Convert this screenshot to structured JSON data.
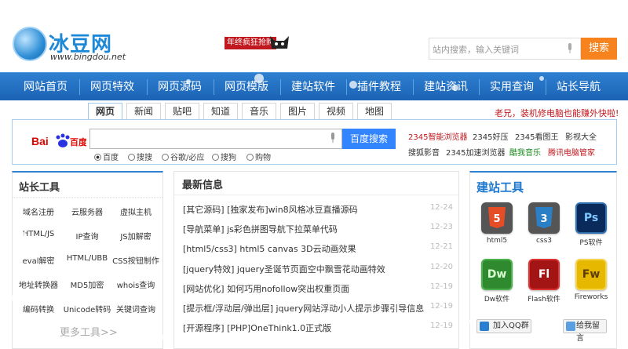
{
  "site": {
    "logo_text": "冰豆网",
    "logo_url": "www.bingdou.net",
    "promo": "年终疯狂抢购",
    "search_placeholder": "站内搜索，输入关键词",
    "search_button": "搜索"
  },
  "nav": [
    "网站首页",
    "网页特效",
    "网页源码",
    "网页模版",
    "建站软件",
    "插件教程",
    "建站资讯",
    "实用查询",
    "站长导航"
  ],
  "tabs": [
    "网页",
    "新闻",
    "贴吧",
    "知道",
    "音乐",
    "图片",
    "视频",
    "地图"
  ],
  "hot_notice": "老兄，装机修电脑也能赚外快啦!",
  "baidu": {
    "logo": "Bai百度",
    "button": "百度搜索",
    "radios": [
      "百度",
      "搜搜",
      "谷歌/必应",
      "搜狗",
      "购物"
    ],
    "links": [
      {
        "text": "2345智能浏览器",
        "color": "#c0181e"
      },
      {
        "text": "2345好压",
        "color": "#333333"
      },
      {
        "text": "2345看图王",
        "color": "#333333"
      },
      {
        "text": "影视大全",
        "color": "#333333"
      },
      {
        "text": "搜狐影音",
        "color": "#333333"
      },
      {
        "text": "2345加速浏览器",
        "color": "#333333"
      },
      {
        "text": "酷我音乐",
        "color": "#1a8a1a"
      },
      {
        "text": "腾讯电脑管家",
        "color": "#c0181e"
      }
    ]
  },
  "tools": {
    "title": "站长工具",
    "items": [
      "域名注册",
      "云服务器",
      "虚拟主机",
      "HTML/JS",
      "IP查询",
      "JS加解密",
      "eval解密",
      "HTML/UBB",
      "CSS按钮制作",
      "地址转换器",
      "MD5加密",
      "whois查询",
      "编码转换",
      "Unicode转码",
      "关键词查询"
    ],
    "more": "更多工具>>"
  },
  "news": {
    "title": "最新信息",
    "items": [
      {
        "text": "[其它源码] [独家发布]win8风格冰豆直播源码",
        "date": "12-24"
      },
      {
        "text": "[导航菜单] js彩色拼图导航下拉菜单代码",
        "date": "12-23"
      },
      {
        "text": "[html5/css3] html5 canvas 3D云动画效果",
        "date": "12-21"
      },
      {
        "text": "[jquery特效] jquery圣诞节页面空中飘雪花动画特效",
        "date": "12-20"
      },
      {
        "text": "[网站优化] 如何巧用nofollow突出权重页面",
        "date": "12-19"
      },
      {
        "text": "[提示框/浮动层/弹出层] jquery网站浮动小人提示步骤引导信息",
        "date": "12-19"
      },
      {
        "text": "[开源程序] [PHP]OneThink1.0正式版",
        "date": "12-19"
      }
    ]
  },
  "build_tools": {
    "title": "建站工具",
    "items": [
      {
        "label": "html5",
        "icon": "html5-icon",
        "glyph": "5",
        "bg": "#e8e8e8",
        "fg": "#e44d26"
      },
      {
        "label": "css3",
        "icon": "css3-icon",
        "glyph": "3",
        "bg": "#e8e8e8",
        "fg": "#2a7fc5"
      },
      {
        "label": "PS软件",
        "icon": "photoshop-icon",
        "glyph": "Ps",
        "bg": "#0a2a5c",
        "fg": "#7ec8ff"
      },
      {
        "label": "Dw软件",
        "icon": "dreamweaver-icon",
        "glyph": "Dw",
        "bg": "#2f8a2f",
        "fg": "#d8ffd0"
      },
      {
        "label": "Flash软件",
        "icon": "flash-icon",
        "glyph": "Fl",
        "bg": "#a31515",
        "fg": "#ffffff"
      },
      {
        "label": "Fireworks",
        "icon": "fireworks-icon",
        "glyph": "Fw",
        "bg": "#e6b800",
        "fg": "#5a3c00"
      }
    ],
    "qq_button": "加入QQ群",
    "message_button": "给我留言"
  }
}
